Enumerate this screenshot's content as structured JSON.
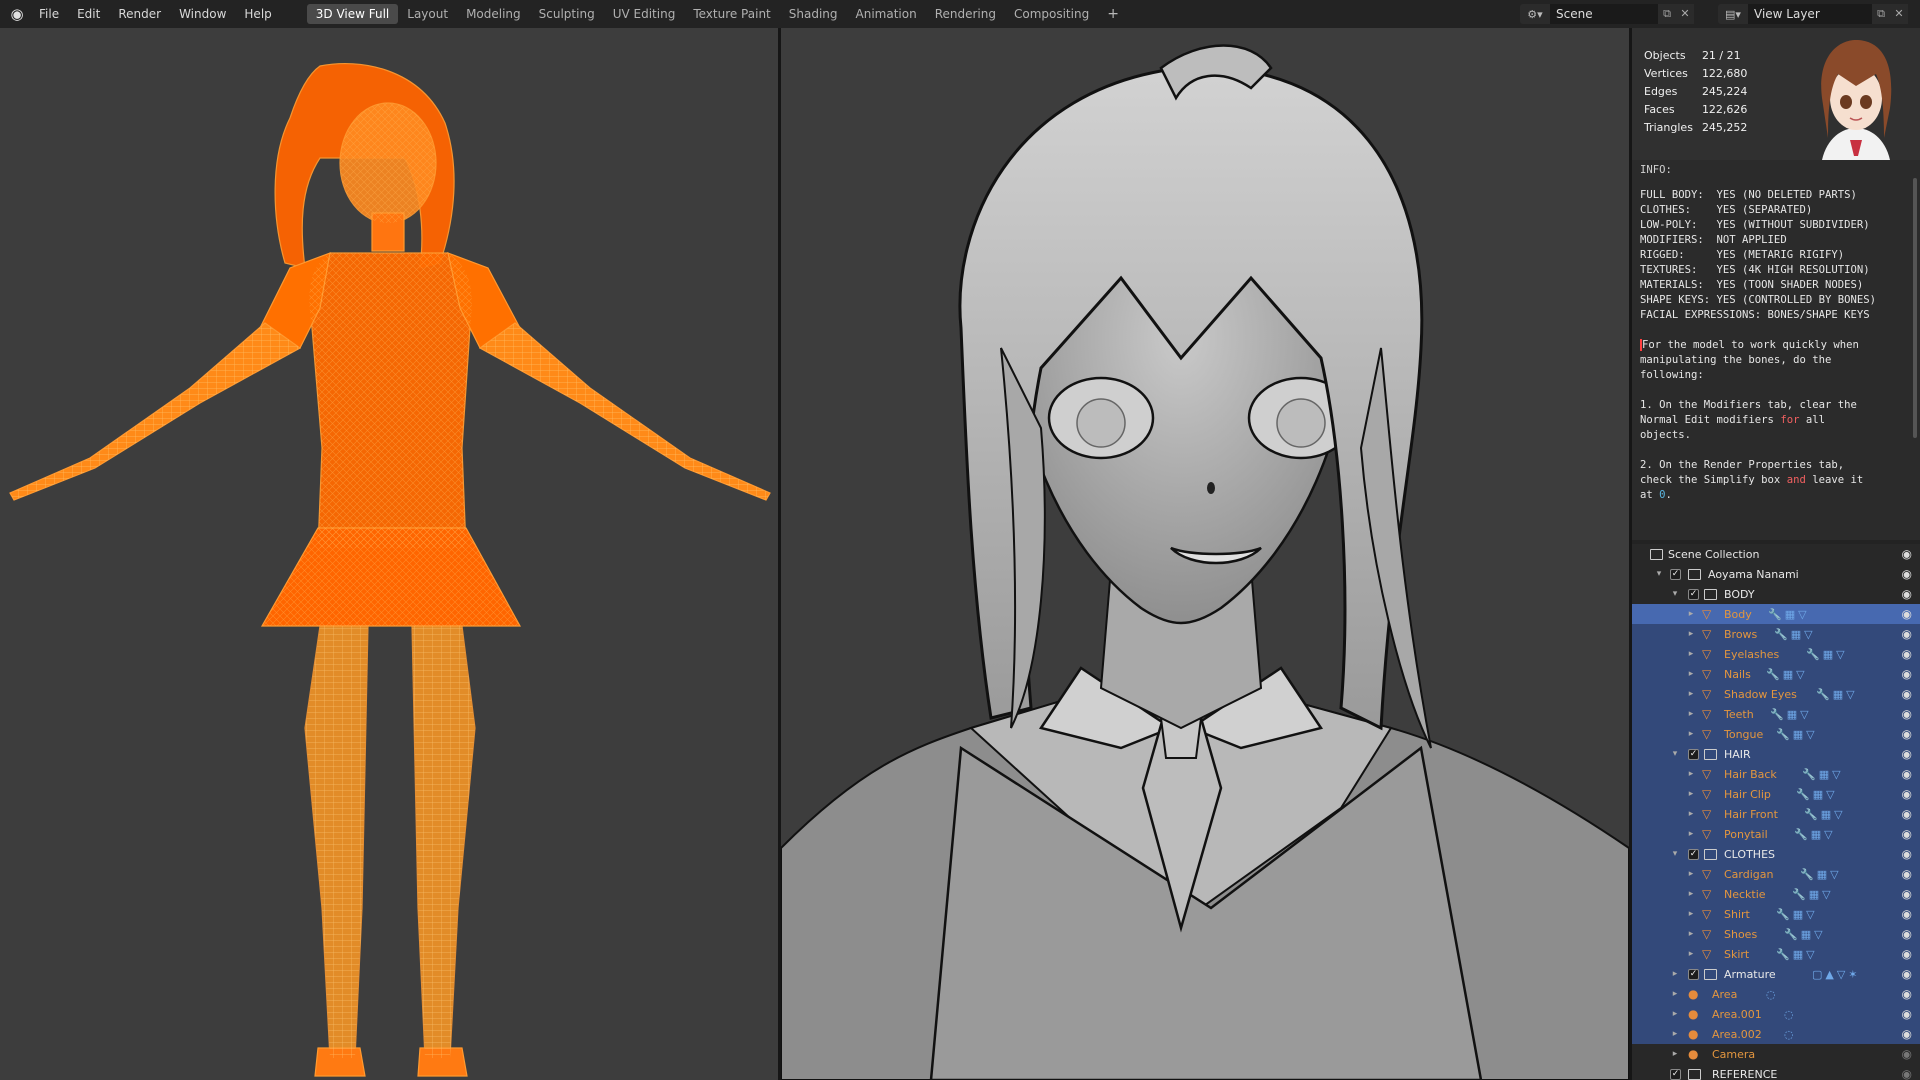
{
  "topbar": {
    "menu": [
      "File",
      "Edit",
      "Render",
      "Window",
      "Help"
    ],
    "tabs": [
      "3D View Full",
      "Layout",
      "Modeling",
      "Sculpting",
      "UV Editing",
      "Texture Paint",
      "Shading",
      "Animation",
      "Rendering",
      "Compositing"
    ],
    "active_tab": "3D View Full",
    "add_tab": "+",
    "scene_label": "Scene",
    "view_layer_label": "View Layer"
  },
  "stats": {
    "rows": [
      {
        "key": "Objects",
        "value": "21 / 21"
      },
      {
        "key": "Vertices",
        "value": "122,680"
      },
      {
        "key": "Edges",
        "value": "245,224"
      },
      {
        "key": "Faces",
        "value": "122,626"
      },
      {
        "key": "Triangles",
        "value": "245,252"
      }
    ]
  },
  "info": {
    "header": "INFO:",
    "lines": [
      "FULL BODY:  YES (NO DELETED PARTS)",
      "CLOTHES:    YES (SEPARATED)",
      "LOW-POLY:   YES (WITHOUT SUBDIVIDER)",
      "MODIFIERS:  NOT APPLIED",
      "RIGGED:     YES (METARIG RIGIFY)",
      "TEXTURES:   YES (4K HIGH RESOLUTION)",
      "MATERIALS:  YES (TOON SHADER NODES)",
      "SHAPE KEYS: YES (CONTROLLED BY BONES)",
      "FACIAL EXPRESSIONS: BONES/SHAPE KEYS"
    ],
    "note1": "For the model to work quickly when\nmanipulating the bones, do the\nfollowing:",
    "step1_a": "1. On the Modifiers tab, clear the\nNormal Edit modifiers ",
    "step1_for": "for",
    "step1_b": " all\nobjects.",
    "step2_a": "2. On the Render Properties tab,\ncheck the Simplify box ",
    "step2_and": "and",
    "step2_b": " leave it\nat ",
    "step2_zero": "0",
    "step2_end": "."
  },
  "outliner": {
    "root": "Scene Collection",
    "collection": "Aoyama Nanami",
    "body_collection": "BODY",
    "body_items": [
      "Body",
      "Brows",
      "Eyelashes",
      "Nails",
      "Shadow Eyes",
      "Teeth",
      "Tongue"
    ],
    "hair_collection": "HAIR",
    "hair_items": [
      "Hair Back",
      "Hair Clip",
      "Hair Front",
      "Ponytail"
    ],
    "clothes_collection": "CLOTHES",
    "clothes_items": [
      "Cardigan",
      "Necktie",
      "Shirt",
      "Shoes",
      "Skirt"
    ],
    "armature": "Armature",
    "lights": [
      "Area",
      "Area.001",
      "Area.002"
    ],
    "camera": "Camera",
    "reference": "REFERENCE"
  },
  "colors": {
    "wire": "#ff7a12",
    "selection": "#33497a",
    "active": "#4769b0",
    "object_text": "#e3963f"
  }
}
